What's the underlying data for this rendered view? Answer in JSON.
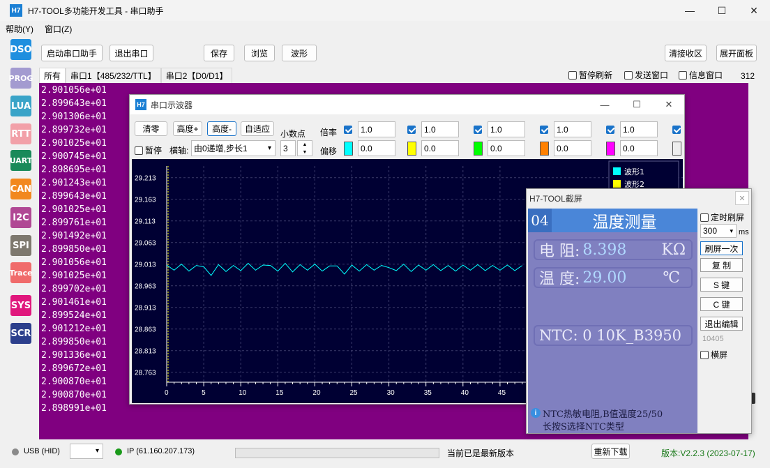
{
  "app": {
    "title": "H7-TOOL多功能开发工具 - 串口助手",
    "logo": "H7",
    "window_controls": [
      "—",
      "☐",
      "✕"
    ]
  },
  "menu": [
    "帮助(Y)",
    "窗口(Z)"
  ],
  "sidebar": [
    {
      "label": "DSO",
      "color": "#1f8fdf"
    },
    {
      "label": "PROG",
      "color": "#a39bd0"
    },
    {
      "label": "LUA",
      "color": "#3aa4c8"
    },
    {
      "label": "RTT",
      "color": "#f2a0a8"
    },
    {
      "label": "UART",
      "color": "#1a8a5a"
    },
    {
      "label": "CAN",
      "color": "#f2881e"
    },
    {
      "label": "I2C",
      "color": "#b04894"
    },
    {
      "label": "SPI",
      "color": "#7d786e"
    },
    {
      "label": "Trace",
      "color": "#f06b6b"
    },
    {
      "label": "SYS",
      "color": "#e0187d"
    },
    {
      "label": "SCR",
      "color": "#2c3f8c"
    }
  ],
  "toolbar": {
    "start": "启动串口助手",
    "exit": "退出串口",
    "save": "保存",
    "browse": "浏览",
    "wave": "波形",
    "clear_recv": "清接收区",
    "expand": "展开面板"
  },
  "tabs": [
    "所有",
    "串口1【485/232/TTL】",
    "串口2【D0/D1】"
  ],
  "options": {
    "pause_refresh": "暂停刷新",
    "send_window": "发送窗口",
    "info_window": "信息窗口",
    "count": "312"
  },
  "recv_lines": [
    "2.901056e+01",
    "2.899643e+01",
    "2.901306e+01",
    "2.899732e+01",
    "2.901025e+01",
    "2.900745e+01",
    "2.898695e+01",
    "2.901243e+01",
    "2.899643e+01",
    "2.901025e+01",
    "2.899761e+01",
    "2.901492e+01",
    "2.899850e+01",
    "2.901056e+01",
    "2.901025e+01",
    "2.899702e+01",
    "2.901461e+01",
    "2.899524e+01",
    "2.901212e+01",
    "2.899850e+01",
    "2.901336e+01",
    "2.899672e+01",
    "2.900870e+01",
    "2.900870e+01",
    "2.898991e+01"
  ],
  "oscilloscope": {
    "title": "串口示波器",
    "clear": "清零",
    "height_plus": "高度+",
    "height_minus": "高度-",
    "auto": "自适应",
    "decimals_label": "小数点",
    "decimals_value": "3",
    "pause": "暂停",
    "xaxis_label": "横轴:",
    "xaxis_mode": "由0递增,步长1",
    "scale_label": "倍率",
    "offset_label": "偏移",
    "channels": [
      {
        "scale": "1.0",
        "offset": "0.0",
        "color": "#00ffff"
      },
      {
        "scale": "1.0",
        "offset": "0.0",
        "color": "#ffff00"
      },
      {
        "scale": "1.0",
        "offset": "0.0",
        "color": "#00ff00"
      },
      {
        "scale": "1.0",
        "offset": "0.0",
        "color": "#ff8000"
      },
      {
        "scale": "1.0",
        "offset": "0.0",
        "color": "#ff00ff"
      }
    ],
    "legend": [
      "波形1",
      "波形2"
    ],
    "trace_color": "#00ffff"
  },
  "chart_data": {
    "type": "line",
    "xlabel": "",
    "ylabel": "",
    "xlim": [
      0,
      48
    ],
    "ylim": [
      28.74,
      29.24
    ],
    "yticks": [
      "29.213",
      "29.163",
      "29.113",
      "29.063",
      "29.013",
      "28.963",
      "28.913",
      "28.863",
      "28.813",
      "28.763"
    ],
    "xticks": [
      "0",
      "5",
      "10",
      "15",
      "20",
      "25",
      "30",
      "35",
      "40",
      "45"
    ],
    "series": [
      {
        "name": "波形1",
        "x": [
          0,
          1,
          2,
          3,
          4,
          5,
          6,
          7,
          8,
          9,
          10,
          11,
          12,
          13,
          14,
          15,
          16,
          17,
          18,
          19,
          20,
          21,
          22,
          23,
          24,
          25,
          26,
          27,
          28,
          29,
          30,
          31,
          32,
          33,
          34,
          35,
          36,
          37,
          38,
          39,
          40,
          41,
          42,
          43,
          44,
          45,
          46,
          47,
          48
        ],
        "values": [
          29.011,
          28.999,
          29.013,
          28.997,
          29.01,
          29.007,
          28.987,
          29.012,
          28.996,
          29.01,
          28.998,
          29.015,
          28.999,
          29.011,
          29.01,
          28.997,
          29.015,
          28.995,
          29.012,
          28.999,
          29.013,
          28.997,
          29.009,
          29.009,
          28.99,
          29.011,
          28.997,
          29.012,
          28.999,
          29.01,
          29.005,
          28.998,
          29.013,
          28.996,
          29.011,
          28.999,
          29.012,
          28.998,
          29.01,
          28.997,
          29.011,
          28.999,
          29.012,
          28.998,
          29.01,
          28.999,
          29.011,
          28.998,
          29.01
        ]
      }
    ]
  },
  "capture": {
    "title": "H7-TOOL截屏",
    "page_num": "04",
    "page_title": "温度测量",
    "r_label": "电 阻:",
    "r_value": "8.398",
    "r_unit": "KΩ",
    "t_label": "温 度:",
    "t_value": "29.00",
    "t_unit": "℃",
    "ntc": "NTC: 0 10K_B3950",
    "hint1": "NTC热敏电阻,B值温度25/50",
    "hint2": "长按S选择NTC类型",
    "timed_refresh": "定时刷屏",
    "interval": "300",
    "ms": "ms",
    "refresh_once": "刷屏一次",
    "copy": "复 制",
    "s_key": "S 键",
    "c_key": "C 键",
    "exit_edit": "退出编辑",
    "counter": "10405",
    "landscape": "横屏",
    "header_color": "#4a86d8",
    "screen_color": "#8080c0"
  },
  "statusbar": {
    "usb": "USB (HID)",
    "ip": "IP (61.160.207.173)",
    "latest": "当前已是最新版本",
    "download": "重新下载",
    "version": "版本:V2.2.3 (2023-07-17)",
    "version_color": "#1a7a1a"
  }
}
